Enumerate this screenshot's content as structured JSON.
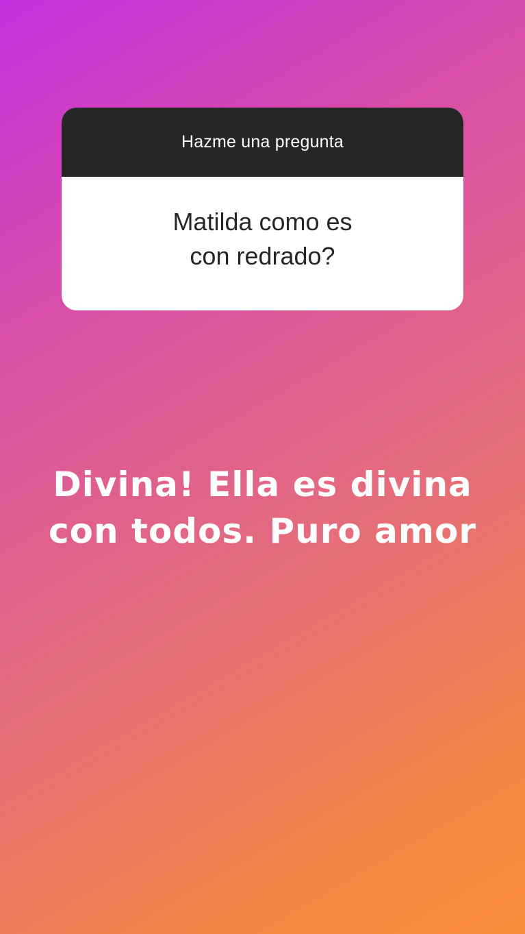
{
  "story": {
    "background_colors": [
      "#c630e0",
      "#d84fa8",
      "#e56c7c",
      "#f98c38"
    ],
    "question_sticker": {
      "header": "Hazme una pregunta",
      "question": "Matilda  como es\ncon redrado?"
    },
    "answer": "Divina! Ella es divina\ncon todos. Puro amor"
  }
}
